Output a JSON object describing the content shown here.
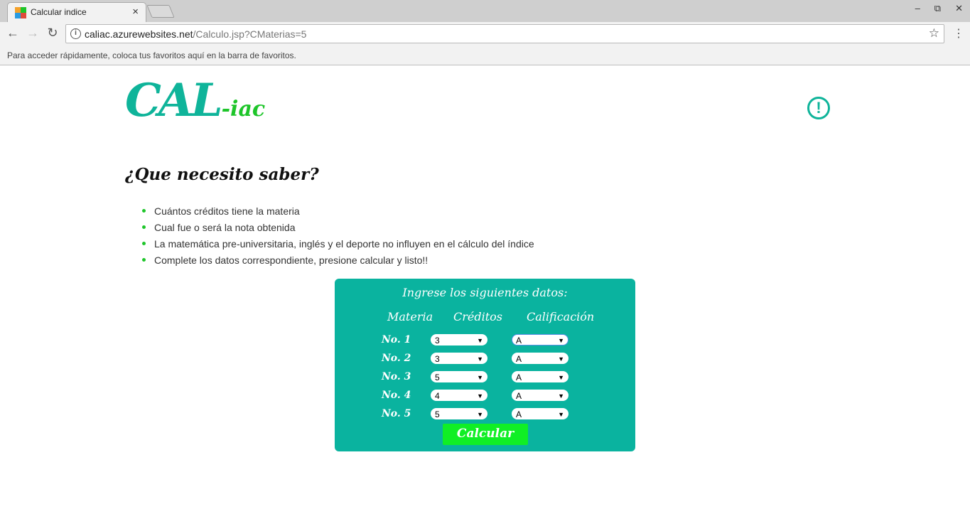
{
  "browser": {
    "tab_title": "Calcular indice",
    "tab_close": "×",
    "window_controls": [
      "–",
      "⧉",
      "✕"
    ],
    "url_host": "caliac.azurewebsites.net",
    "url_path": "/Calculo.jsp?CMaterias=5",
    "bookmarks_hint": "Para acceder rápidamente, coloca tus favoritos aquí en la barra de favoritos.",
    "icons": {
      "back": "←",
      "forward": "→",
      "reload": "↻",
      "info": "i",
      "star": "☆",
      "menu": "⋮"
    }
  },
  "header": {
    "logo_main": "CAL",
    "logo_sub": "-iac",
    "alert_icon": "!"
  },
  "intro": {
    "heading": "¿Que necesito saber?",
    "items": [
      "Cuántos créditos tiene la materia",
      "Cual fue o será la nota obtenida",
      "La matemática pre-universitaria, inglés y el deporte no influyen en el cálculo del índice",
      "Complete los datos correspondiente, presione calcular y listo!!"
    ]
  },
  "form": {
    "title": "Ingrese los siguientes datos:",
    "columns": [
      "Materia",
      "Créditos",
      "Calificación"
    ],
    "rows": [
      {
        "label": "No. 1",
        "credits": "3",
        "grade": "A"
      },
      {
        "label": "No. 2",
        "credits": "3",
        "grade": "A"
      },
      {
        "label": "No. 3",
        "credits": "5",
        "grade": "A"
      },
      {
        "label": "No. 4",
        "credits": "4",
        "grade": "A"
      },
      {
        "label": "No. 5",
        "credits": "5",
        "grade": "A"
      }
    ],
    "submit_label": "Calcular"
  },
  "colors": {
    "accent": "#0ab39f",
    "button": "#10ef25",
    "logo_sub": "#1ec52a"
  }
}
